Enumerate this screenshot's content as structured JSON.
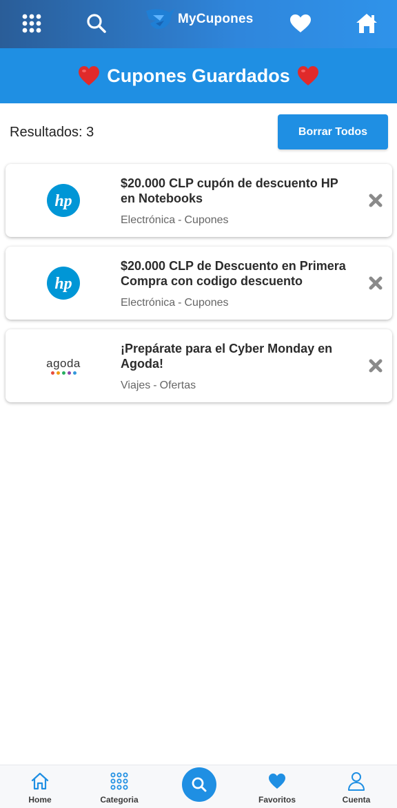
{
  "header": {
    "brand": "MyCupones",
    "icons": [
      "grid-icon",
      "search-icon",
      "logo-icon",
      "heart-icon",
      "home-icon"
    ]
  },
  "banner": {
    "title": "Cupones Guardados"
  },
  "results": {
    "label": "Resultados: 3",
    "clear_button": "Borrar Todos"
  },
  "coupons": [
    {
      "logo": "hp-logo",
      "title": "$20.000 CLP cupón de descuento HP en Notebooks",
      "category": "Electrónica",
      "type": "Cupones"
    },
    {
      "logo": "hp-logo",
      "title": "$20.000 CLP de Descuento en Primera Compra con codigo descuento",
      "category": "Electrónica",
      "type": "Cupones"
    },
    {
      "logo": "agoda-logo",
      "logo_text": "agoda",
      "title": "¡Prepárate para el Cyber Monday en Agoda!",
      "category": "Viajes",
      "type": "Ofertas"
    }
  ],
  "meta_separator": "-",
  "bottom_nav": {
    "home": "Home",
    "categoria": "Categoria",
    "favoritos": "Favoritos",
    "cuenta": "Cuenta"
  },
  "colors": {
    "primary": "#1f8fe3",
    "header_gradient_start": "#2a5d98",
    "header_gradient_end": "#2f93ea",
    "heart_red": "#e02a2a",
    "hp_blue": "#0096d6",
    "remove_gray": "#8a8a8a",
    "agoda_dots": [
      "#e74c3c",
      "#f39c12",
      "#27ae60",
      "#8e44ad",
      "#3498db"
    ]
  }
}
